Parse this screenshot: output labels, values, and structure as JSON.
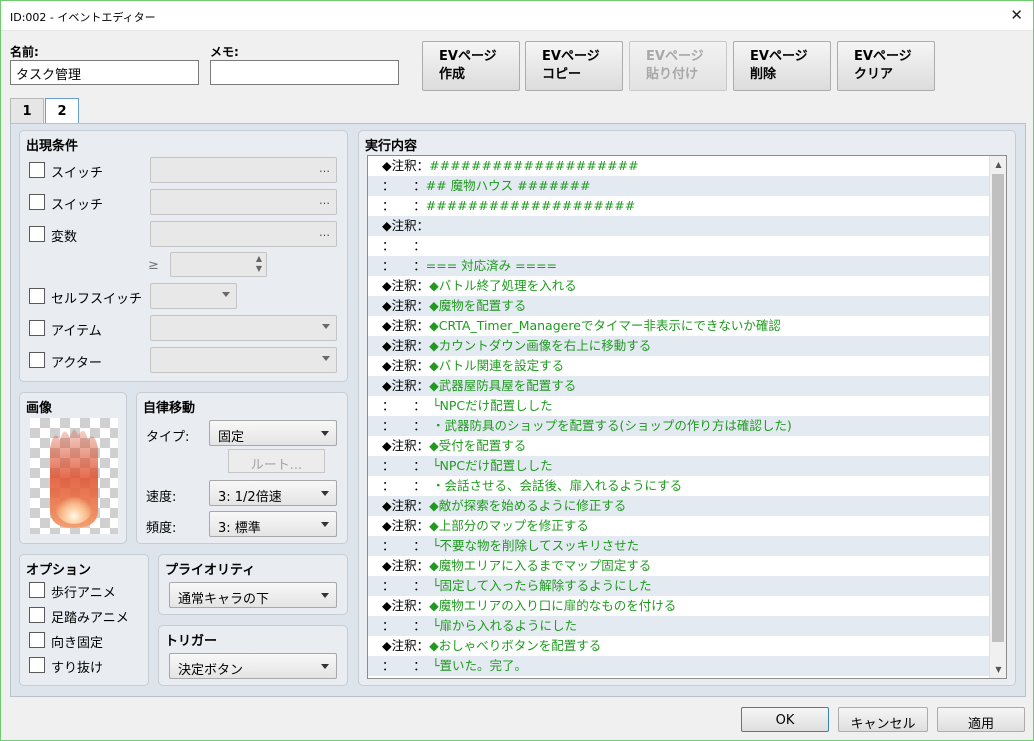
{
  "window": {
    "title": "ID:002 - イベントエディター",
    "close_glyph": "✕"
  },
  "header": {
    "name_label": "名前:",
    "name_value": "タスク管理",
    "memo_label": "メモ:",
    "memo_value": ""
  },
  "ev_buttons": [
    {
      "line1": "EVページ",
      "line2": "作成",
      "enabled": true
    },
    {
      "line1": "EVページ",
      "line2": "コピー",
      "enabled": true
    },
    {
      "line1": "EVページ",
      "line2": "貼り付け",
      "enabled": false
    },
    {
      "line1": "EVページ",
      "line2": "削除",
      "enabled": true
    },
    {
      "line1": "EVページ",
      "line2": "クリア",
      "enabled": true
    }
  ],
  "tabs": [
    {
      "label": "1"
    },
    {
      "label": "2",
      "active": true
    }
  ],
  "conditions": {
    "title": "出現条件",
    "switch1": "スイッチ",
    "switch2": "スイッチ",
    "variable": "変数",
    "ge": "≥",
    "self_switch": "セルフスイッチ",
    "item": "アイテム",
    "actor": "アクター",
    "dots": "…"
  },
  "image_panel": {
    "title": "画像"
  },
  "autonomous": {
    "title": "自律移動",
    "type_label": "タイプ:",
    "type_value": "固定",
    "route_label": "ルート...",
    "speed_label": "速度:",
    "speed_value": "3: 1/2倍速",
    "freq_label": "頻度:",
    "freq_value": "3: 標準"
  },
  "options": {
    "title": "オプション",
    "walk": "歩行アニメ",
    "step": "足踏みアニメ",
    "dir_fix": "向き固定",
    "through": "すり抜け"
  },
  "priority": {
    "title": "プライオリティ",
    "value": "通常キャラの下"
  },
  "trigger": {
    "title": "トリガー",
    "value": "決定ボタン"
  },
  "content": {
    "title": "実行内容",
    "rows": [
      {
        "prefix": "◆注釈：",
        "text": "####################"
      },
      {
        "prefix": "：　　：",
        "text": "## 魔物ハウス #######"
      },
      {
        "prefix": "：　　：",
        "text": "####################"
      },
      {
        "prefix": "◆注釈：",
        "text": ""
      },
      {
        "prefix": "：　　：",
        "text": ""
      },
      {
        "prefix": "：　　：",
        "text": "=== 対応済み ===="
      },
      {
        "prefix": "◆注釈：",
        "text": "◆バトル終了処理を入れる"
      },
      {
        "prefix": "◆注釈：",
        "text": "◆魔物を配置する"
      },
      {
        "prefix": "◆注釈：",
        "text": "◆CRTA_Timer_Managereでタイマー非表示にできないか確認"
      },
      {
        "prefix": "◆注釈：",
        "text": "◆カウントダウン画像を右上に移動する"
      },
      {
        "prefix": "◆注釈：",
        "text": "◆バトル関連を設定する"
      },
      {
        "prefix": "◆注釈：",
        "text": "◆武器屋防具屋を配置する"
      },
      {
        "prefix": "：　　：",
        "text": "　└NPCだけ配置しした"
      },
      {
        "prefix": "：　　：",
        "text": "　・武器防具のショップを配置する(ショップの作り方は確認した)"
      },
      {
        "prefix": "◆注釈：",
        "text": "◆受付を配置する"
      },
      {
        "prefix": "：　　：",
        "text": "　└NPCだけ配置しした"
      },
      {
        "prefix": "：　　：",
        "text": "　・会話させる、会話後、扉入れるようにする"
      },
      {
        "prefix": "◆注釈：",
        "text": "◆敵が探索を始めるように修正する"
      },
      {
        "prefix": "◆注釈：",
        "text": "◆上部分のマップを修正する"
      },
      {
        "prefix": "：　　：",
        "text": "　└不要な物を削除してスッキリさせた"
      },
      {
        "prefix": "◆注釈：",
        "text": "◆魔物エリアに入るまでマップ固定する"
      },
      {
        "prefix": "：　　：",
        "text": "　└固定して入ったら解除するようにした"
      },
      {
        "prefix": "◆注釈：",
        "text": "◆魔物エリアの入り口に扉的なものを付ける"
      },
      {
        "prefix": "：　　：",
        "text": "　└扉から入れるようにした"
      },
      {
        "prefix": "◆注釈：",
        "text": "◆おしゃべりボタンを配置する"
      },
      {
        "prefix": "：　　：",
        "text": "　└置いた。完了。"
      }
    ]
  },
  "footer": {
    "ok": "OK",
    "cancel": "キャンセル",
    "apply": "適用"
  },
  "colors": {
    "comment_green": "#1f9a1f",
    "focus_border": "#6fcb6f"
  }
}
